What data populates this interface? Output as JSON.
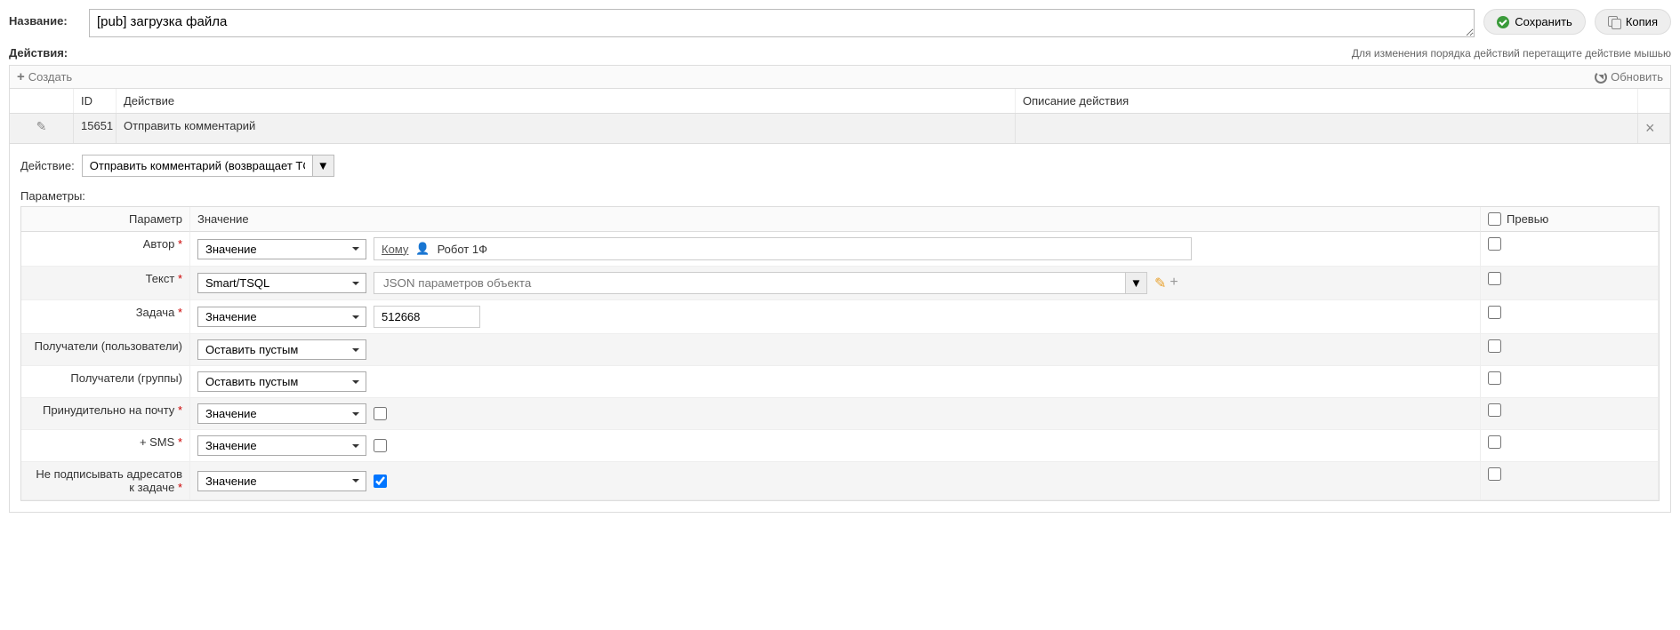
{
  "labels": {
    "name": "Название:",
    "actions": "Действия:",
    "hint": "Для изменения порядка действий перетащите действие мышью",
    "create": "Создать",
    "refresh": "Обновить",
    "action_field": "Действие:",
    "params": "Параметры:"
  },
  "title_value": "[pub] загрузка файла",
  "buttons": {
    "save": "Сохранить",
    "copy": "Копия"
  },
  "grid": {
    "headers": {
      "id": "ID",
      "action": "Действие",
      "desc": "Описание действия"
    },
    "row": {
      "id": "15651",
      "action": "Отправить комментарий",
      "desc": ""
    }
  },
  "action_select": "Отправить комментарий (возвращает TCCI.",
  "params_headers": {
    "param": "Параметр",
    "value": "Значение",
    "preview": "Превью"
  },
  "params": {
    "author": {
      "label": "Автор",
      "mode": "Значение",
      "to": "Кому",
      "robot": "Робот 1Ф"
    },
    "text": {
      "label": "Текст",
      "mode": "Smart/TSQL",
      "json_ph": "JSON параметров объекта"
    },
    "task": {
      "label": "Задача",
      "mode": "Значение",
      "value": "512668"
    },
    "recip_users": {
      "label": "Получатели (пользователи)",
      "mode": "Оставить пустым"
    },
    "recip_groups": {
      "label": "Получатели (группы)",
      "mode": "Оставить пустым"
    },
    "force_mail": {
      "label": "Принудительно на почту",
      "mode": "Значение"
    },
    "sms": {
      "label": "+ SMS",
      "mode": "Значение"
    },
    "no_sign": {
      "label": "Не подписывать адресатов к задаче",
      "mode": "Значение"
    }
  }
}
